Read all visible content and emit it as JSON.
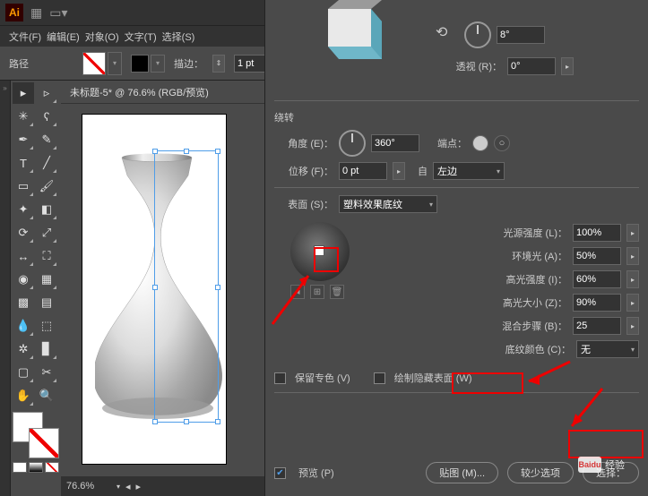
{
  "app": {
    "logo": "Ai"
  },
  "menu": {
    "file": "文件(F)",
    "edit": "编辑(E)",
    "object": "对象(O)",
    "type": "文字(T)",
    "select": "选择(S)"
  },
  "controlbar": {
    "path": "路径",
    "stroke_label": "描边：",
    "stroke_value": "1 pt"
  },
  "doc": {
    "tab": "未标题-5* @ 76.6% (RGB/预览)",
    "zoom": "76.6%"
  },
  "panel": {
    "perspective_label": "透视 (R)：",
    "perspective_value": "0°",
    "angle_tr_value": "8°",
    "revolve_title": "绕转",
    "angle_label": "角度 (E)：",
    "angle_value": "360°",
    "cap_label": "端点：",
    "offset_label": "位移 (F)：",
    "offset_value": "0 pt",
    "from_label": "自",
    "from_value": "左边",
    "surface_label": "表面 (S)：",
    "surface_value": "塑料效果底纹",
    "light_intensity_label": "光源强度 (L)：",
    "light_intensity_value": "100%",
    "ambient_label": "环境光 (A)：",
    "ambient_value": "50%",
    "highlight_intensity_label": "高光强度 (I)：",
    "highlight_intensity_value": "60%",
    "highlight_size_label": "高光大小 (Z)：",
    "highlight_size_value": "90%",
    "blend_steps_label": "混合步骤 (B)：",
    "blend_steps_value": "25",
    "shading_color_label": "底纹颜色 (C)：",
    "shading_color_value": "无",
    "preserve_spot": "保留专色 (V)",
    "draw_hidden": "绘制隐藏表面 (W)",
    "preview": "预览 (P)",
    "map_art": "贴图 (M)...",
    "fewer_options": "较少选项",
    "select_btn": "选择："
  },
  "watermark": {
    "brand": "Baidu",
    "text": "经验"
  }
}
